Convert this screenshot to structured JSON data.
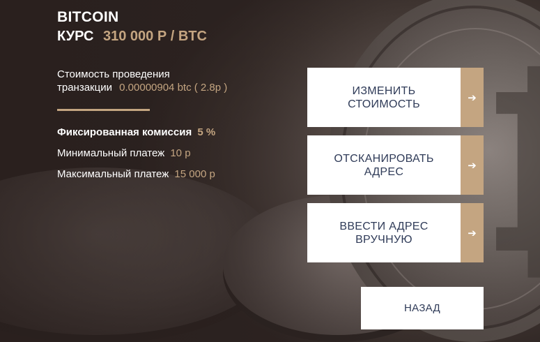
{
  "header": {
    "title": "BITCOIN",
    "rate_label": "КУРС",
    "rate_value": "310 000 Р / BTC"
  },
  "transaction_cost": {
    "label_line1": "Стоимость проведения",
    "label_line2": "транзакции",
    "value": "0.00000904 btc ( 2.8р )"
  },
  "fees": [
    {
      "label": "Фиксированная комиссия",
      "value": "5 %"
    },
    {
      "label": "Минимальный платеж",
      "value": "10 р"
    },
    {
      "label": "Максимальный платеж",
      "value": "15 000 р"
    }
  ],
  "actions": [
    {
      "line1": "ИЗМЕНИТЬ",
      "line2": "СТОИМОСТЬ",
      "icon": "arrow-right-icon"
    },
    {
      "line1": "ОТСКАНИРОВАТЬ",
      "line2": "АДРЕС",
      "icon": "arrow-right-icon"
    },
    {
      "line1": "ВВЕСТИ АДРЕС",
      "line2": "ВРУЧНУЮ",
      "icon": "arrow-right-icon"
    }
  ],
  "back_button": {
    "label": "НАЗАД"
  },
  "arrow_glyph": "➔",
  "colors": {
    "accent": "#c4a581",
    "button_text": "#2f3b58",
    "button_bg": "#ffffff",
    "text": "#ffffff"
  }
}
